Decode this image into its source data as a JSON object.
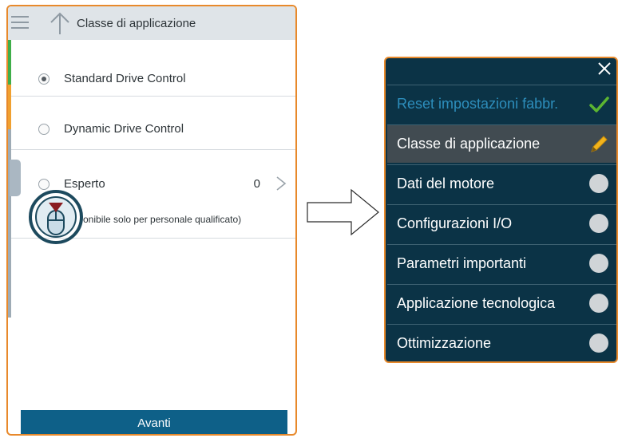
{
  "left_panel": {
    "title": "Classe di applicazione",
    "options": [
      {
        "label": "Standard Drive Control",
        "selected": true
      },
      {
        "label": "Dynamic Drive Control",
        "selected": false
      },
      {
        "label": "Esperto",
        "selected": false,
        "count": "0",
        "note": "onibile solo per personale qualificato)"
      }
    ],
    "next_label": "Avanti"
  },
  "right_panel": {
    "items": [
      {
        "label": "Reset impostazioni fabbr.",
        "status": "check-icon"
      },
      {
        "label": "Classe di applicazione",
        "status": "pencil-icon"
      },
      {
        "label": "Dati del motore",
        "status": "circle-icon"
      },
      {
        "label": "Configurazioni I/O",
        "status": "circle-icon"
      },
      {
        "label": "Parametri importanti",
        "status": "circle-icon"
      },
      {
        "label": "Applicazione tecnologica",
        "status": "circle-icon"
      },
      {
        "label": "Ottimizzazione",
        "status": "circle-icon"
      }
    ]
  },
  "colors": {
    "accent_border": "#e8892b",
    "panel_dark": "#0b3346",
    "button_blue": "#0e6088",
    "done_text": "#2d8ebc",
    "check_green": "#5cb531",
    "pencil_yellow": "#f2b31b"
  }
}
